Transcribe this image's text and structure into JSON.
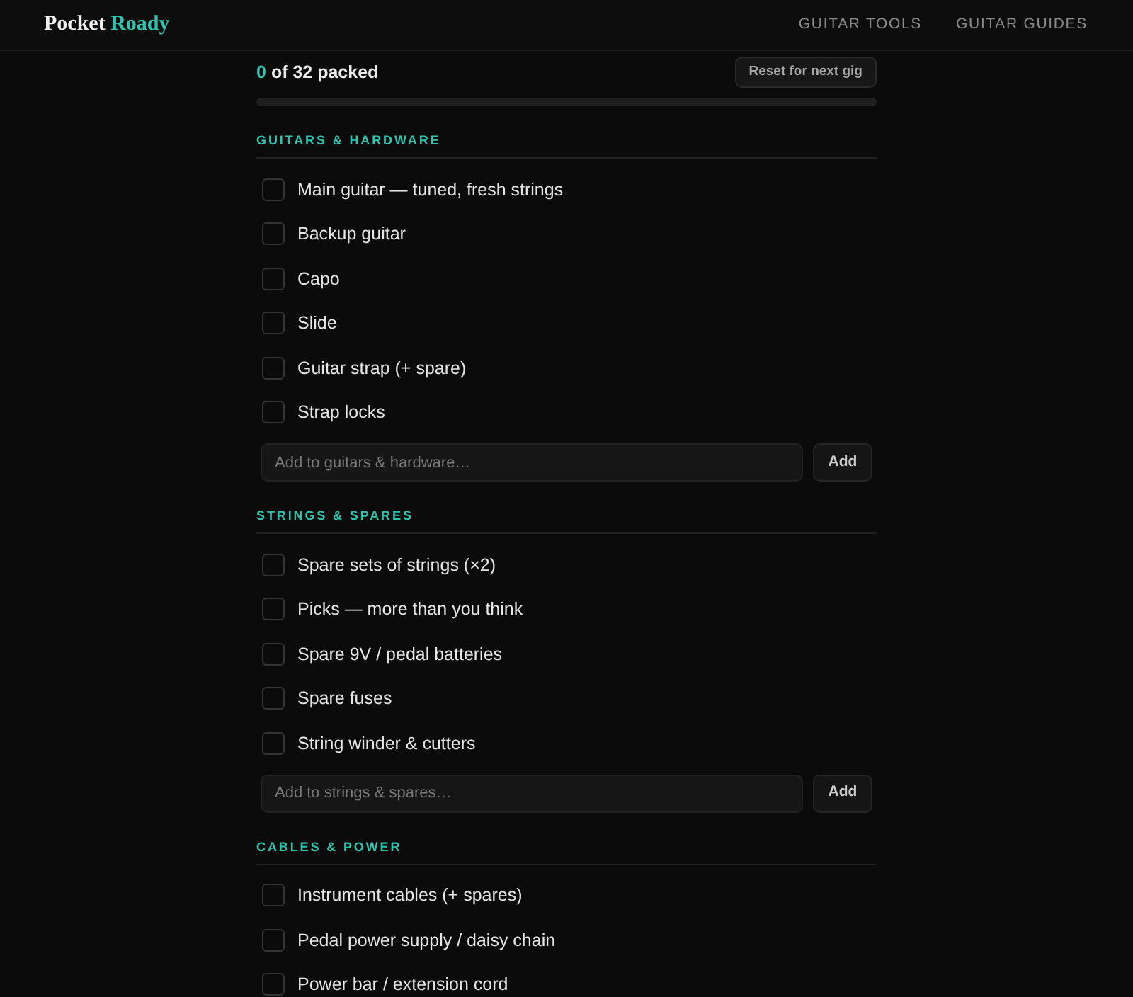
{
  "header": {
    "logo": {
      "first": "Pocket",
      "second": "Roady"
    },
    "nav": [
      {
        "label": "GUITAR TOOLS"
      },
      {
        "label": "GUITAR GUIDES"
      }
    ]
  },
  "progress": {
    "count": "0",
    "label": "of 32 packed",
    "reset_button": "Reset for next gig",
    "level": 0
  },
  "sections": [
    {
      "title": "GUITARS & HARDWARE",
      "items": [
        {
          "label": "Main guitar — tuned, fresh strings",
          "checked": false
        },
        {
          "label": "Backup guitar",
          "checked": false
        },
        {
          "label": "Capo",
          "checked": false
        },
        {
          "label": "Slide",
          "checked": false
        },
        {
          "label": "Guitar strap (+ spare)",
          "checked": false
        },
        {
          "label": "Strap locks",
          "checked": false
        }
      ],
      "add_placeholder": "Add to guitars & hardware…",
      "add_button": "Add"
    },
    {
      "title": "STRINGS & SPARES",
      "items": [
        {
          "label": "Spare sets of strings (×2)",
          "checked": false
        },
        {
          "label": "Picks — more than you think",
          "checked": false
        },
        {
          "label": "Spare 9V / pedal batteries",
          "checked": false
        },
        {
          "label": "Spare fuses",
          "checked": false
        },
        {
          "label": "String winder & cutters",
          "checked": false
        }
      ],
      "add_placeholder": "Add to strings & spares…",
      "add_button": "Add"
    },
    {
      "title": "CABLES & POWER",
      "items": [
        {
          "label": "Instrument cables (+ spares)",
          "checked": false
        },
        {
          "label": "Pedal power supply / daisy chain",
          "checked": false
        },
        {
          "label": "Power bar / extension cord",
          "checked": false
        }
      ]
    }
  ]
}
